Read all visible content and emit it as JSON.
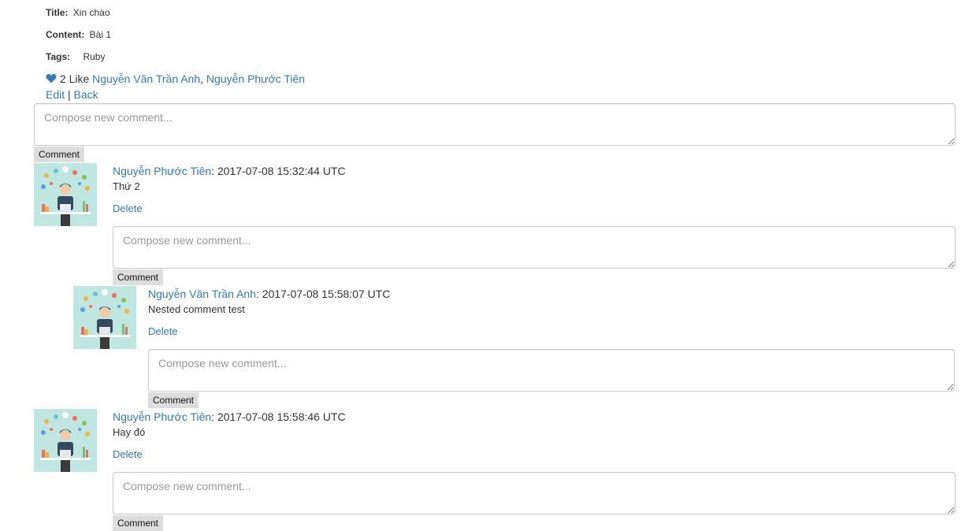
{
  "post": {
    "title_label": "Title:",
    "title": "Xin chào",
    "content_label": "Content:",
    "content": "Bài 1",
    "tags_label": "Tags:",
    "tags": [
      "Ruby"
    ],
    "like_count_text": "2 Like",
    "likers": [
      "Nguyễn Văn Trần Anh",
      "Nguyễn Phước Tiên"
    ],
    "liker_separator": ",",
    "edit_label": "Edit",
    "action_separator": "|",
    "back_label": "Back"
  },
  "compose": {
    "placeholder": "Compose new comment...",
    "button_label": "Comment"
  },
  "comments": [
    {
      "author": "Nguyễn Phước Tiên",
      "timestamp": ": 2017-07-08 15:32:44 UTC",
      "body": "Thứ 2",
      "delete_label": "Delete",
      "depth": 0
    },
    {
      "author": "Nguyễn Văn Trần Anh",
      "timestamp": ": 2017-07-08 15:58:07 UTC",
      "body": "Nested comment test",
      "delete_label": "Delete",
      "depth": 1
    },
    {
      "author": "Nguyễn Phước Tiên",
      "timestamp": ": 2017-07-08 15:58:46 UTC",
      "body": "Hay đó",
      "delete_label": "Delete",
      "depth": 0
    }
  ],
  "colors": {
    "link": "#337ab7",
    "button_bg": "#dddddd",
    "avatar_bg": "#bfe6e0"
  },
  "icons": {
    "like": "heart-icon",
    "avatar": "avatar-illustration"
  }
}
